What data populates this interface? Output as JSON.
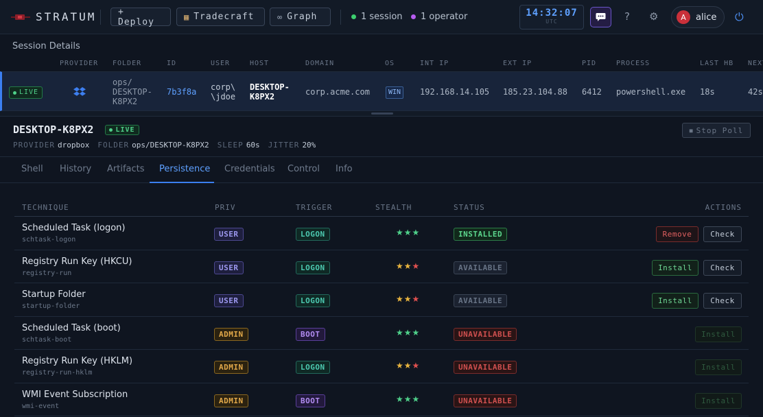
{
  "app": {
    "name": "STRATUM"
  },
  "topbar": {
    "deploy_label": "+ Deploy",
    "tradecraft_label": "Tradecraft",
    "graph_label": "Graph",
    "sessions": "1 session",
    "operators": "1 operator",
    "clock_time": "14:32:07",
    "clock_zone": "UTC",
    "help": "?",
    "user_initial": "A",
    "user_name": "alice",
    "colors": {
      "accent": "#3b7ff0",
      "session_dot": "#3ccf6e",
      "operator_dot": "#b65cf0"
    }
  },
  "session_details": {
    "title": "Session Details",
    "columns": [
      "PROVIDER",
      "FOLDER",
      "ID",
      "USER",
      "HOST",
      "DOMAIN",
      "OS",
      "INT IP",
      "EXT IP",
      "PID",
      "PROCESS",
      "LAST HB",
      "NEXT"
    ],
    "row": {
      "status": "LIVE",
      "provider_icon": "dropbox-icon",
      "folder_l1": "ops/",
      "folder_l2": "DESKTOP-",
      "folder_l3": "K8PX2",
      "id": "7b3f8a",
      "user_l1": "corp\\",
      "user_l2": "\\jdoe",
      "host_l1": "DESKTOP-",
      "host_l2": "K8PX2",
      "domain": "corp.acme.com",
      "os": "WIN",
      "int_ip": "192.168.14.105",
      "ext_ip": "185.23.104.88",
      "pid": "6412",
      "process": "powershell.exe",
      "last_hb": "18s",
      "next": "42s"
    }
  },
  "host_panel": {
    "hostname": "DESKTOP-K8PX2",
    "status": "LIVE",
    "stop_label": "Stop Poll",
    "meta": [
      {
        "key": "PROVIDER",
        "value": "dropbox"
      },
      {
        "key": "FOLDER",
        "value": "ops/DESKTOP-K8PX2"
      },
      {
        "key": "SLEEP",
        "value": "60s"
      },
      {
        "key": "JITTER",
        "value": "20%"
      }
    ]
  },
  "tabs": [
    "Shell",
    "History",
    "Artifacts",
    "Persistence",
    "Credentials",
    "Control",
    "Info"
  ],
  "active_tab": "Persistence",
  "persistence": {
    "headers": {
      "technique": "TECHNIQUE",
      "priv": "PRIV",
      "trigger": "TRIGGER",
      "stealth": "STEALTH",
      "status": "STATUS",
      "actions": "ACTIONS"
    },
    "rows": [
      {
        "name": "Scheduled Task (logon)",
        "id": "schtask-logon",
        "priv": "USER",
        "trigger": "LOGON",
        "stealth": 3,
        "status": "INSTALLED",
        "actions": [
          "Remove",
          "Check"
        ]
      },
      {
        "name": "Registry Run Key (HKCU)",
        "id": "registry-run",
        "priv": "USER",
        "trigger": "LOGON",
        "stealth": 2,
        "status": "AVAILABLE",
        "actions": [
          "Install",
          "Check"
        ]
      },
      {
        "name": "Startup Folder",
        "id": "startup-folder",
        "priv": "USER",
        "trigger": "LOGON",
        "stealth": 2,
        "status": "AVAILABLE",
        "actions": [
          "Install",
          "Check"
        ]
      },
      {
        "name": "Scheduled Task (boot)",
        "id": "schtask-boot",
        "priv": "ADMIN",
        "trigger": "BOOT",
        "stealth": 3,
        "status": "UNAVAILABLE",
        "actions": [
          "Install"
        ]
      },
      {
        "name": "Registry Run Key (HKLM)",
        "id": "registry-run-hklm",
        "priv": "ADMIN",
        "trigger": "LOGON",
        "stealth": 2,
        "status": "UNAVAILABLE",
        "actions": [
          "Install"
        ]
      },
      {
        "name": "WMI Event Subscription",
        "id": "wmi-event",
        "priv": "ADMIN",
        "trigger": "BOOT",
        "stealth": 3,
        "status": "UNAVAILABLE",
        "actions": [
          "Install"
        ]
      }
    ]
  }
}
